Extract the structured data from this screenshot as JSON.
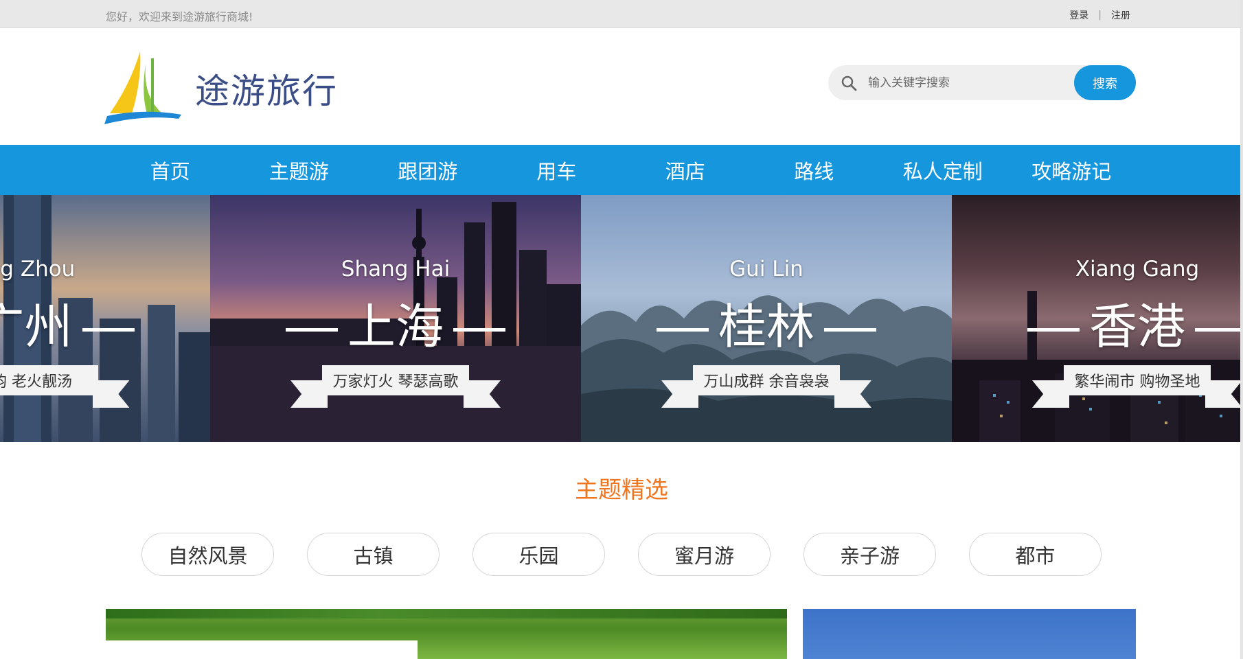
{
  "topbar": {
    "welcome": "您好，欢迎来到途游旅行商城!",
    "login": "登录",
    "separator": "|",
    "register": "注册"
  },
  "header": {
    "brand": "途游旅行",
    "logo_icon": "sail-logo-icon",
    "search": {
      "placeholder": "输入关键字搜索",
      "button": "搜索",
      "icon": "search-icon"
    }
  },
  "nav": {
    "items": [
      {
        "label": "首页"
      },
      {
        "label": "主题游"
      },
      {
        "label": "跟团游"
      },
      {
        "label": "用车"
      },
      {
        "label": "酒店"
      },
      {
        "label": "路线"
      },
      {
        "label": "私人定制"
      },
      {
        "label": "攻略游记"
      }
    ]
  },
  "banner": {
    "panels": [
      {
        "en": "ang Zhou",
        "cn": "广州",
        "tagline": "古韵 老火靓汤"
      },
      {
        "en": "Shang Hai",
        "cn": "上海",
        "tagline": "万家灯火 琴瑟高歌"
      },
      {
        "en": "Gui Lin",
        "cn": "桂林",
        "tagline": "万山成群 余音袅袅"
      },
      {
        "en": "Xiang Gang",
        "cn": "香港",
        "tagline": "繁华闹市 购物圣地"
      }
    ]
  },
  "theme": {
    "title": "主题精选",
    "tags": [
      {
        "label": "自然风景"
      },
      {
        "label": "古镇"
      },
      {
        "label": "乐园"
      },
      {
        "label": "蜜月游"
      },
      {
        "label": "亲子游"
      },
      {
        "label": "都市"
      }
    ]
  },
  "colors": {
    "primary": "#1696dc",
    "accent": "#f0751f",
    "brand_text": "#3a4d86"
  }
}
